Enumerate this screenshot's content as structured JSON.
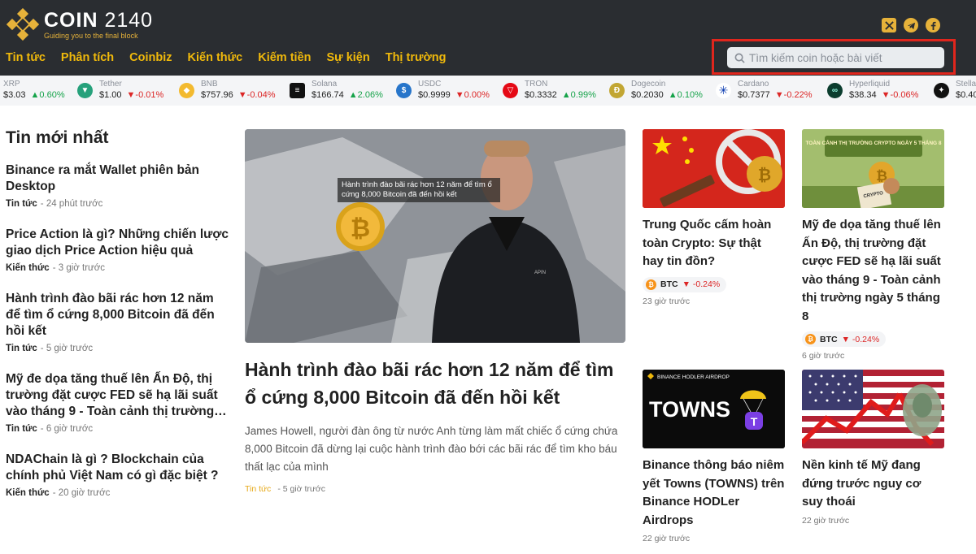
{
  "header": {
    "logo_name": "COIN",
    "logo_number": "2140",
    "logo_tagline": "Guiding you to the final block",
    "nav": [
      "Tin tức",
      "Phân tích",
      "Coinbiz",
      "Kiến thức",
      "Kiếm tiền",
      "Sự kiện",
      "Thị trường"
    ],
    "search_placeholder": "Tìm kiếm coin hoặc bài viết",
    "socials": [
      "x-icon",
      "telegram-icon",
      "facebook-icon"
    ]
  },
  "ticker": [
    {
      "name": "XRP",
      "price": "$3.03",
      "change": "0.60%",
      "direction": "up",
      "icon_color": "#23292f"
    },
    {
      "name": "Tether",
      "price": "$1.00",
      "change": "-0.01%",
      "direction": "down",
      "icon_color": "#26a17b"
    },
    {
      "name": "BNB",
      "price": "$757.96",
      "change": "-0.04%",
      "direction": "down",
      "icon_color": "#f3ba2f"
    },
    {
      "name": "Solana",
      "price": "$166.74",
      "change": "2.06%",
      "direction": "up",
      "icon_color": "#111111"
    },
    {
      "name": "USDC",
      "price": "$0.9999",
      "change": "0.00%",
      "direction": "down",
      "icon_color": "#2775ca"
    },
    {
      "name": "TRON",
      "price": "$0.3332",
      "change": "0.99%",
      "direction": "up",
      "icon_color": "#e50915"
    },
    {
      "name": "Dogecoin",
      "price": "$0.2030",
      "change": "0.10%",
      "direction": "up",
      "icon_color": "#c2a633"
    },
    {
      "name": "Cardano",
      "price": "$0.7377",
      "change": "-0.22%",
      "direction": "down",
      "icon_color": "#0033ad"
    },
    {
      "name": "Hyperliquid",
      "price": "$38.34",
      "change": "-0.06%",
      "direction": "down",
      "icon_color": "#0b3d2e"
    },
    {
      "name": "Stella",
      "price": "$0.40",
      "change": "",
      "direction": "up",
      "icon_color": "#111111"
    }
  ],
  "latest": {
    "title": "Tin mới nhất",
    "items": [
      {
        "headline": "Binance ra mắt Wallet phiên bản Desktop",
        "category": "Tin tức",
        "time": "- 24 phút trước"
      },
      {
        "headline": "Price Action là gì? Những chiến lược giao dịch Price Action hiệu quả",
        "category": "Kiến thức",
        "time": "- 3 giờ trước"
      },
      {
        "headline": "Hành trình đào bãi rác hơn 12 năm để tìm ổ cứng 8,000 Bitcoin đã đến hồi kết",
        "category": "Tin tức",
        "time": "- 5 giờ trước"
      },
      {
        "headline": "Mỹ đe dọa tăng thuế lên Ấn Độ, thị trường đặt cược FED sẽ hạ lãi suất vào tháng 9 - Toàn cảnh thị trường…",
        "category": "Tin tức",
        "time": "- 6 giờ trước"
      },
      {
        "headline": "NDAChain là gì ? Blockchain của chính phủ Việt Nam có gì đặc biệt ?",
        "category": "Kiến thức",
        "time": "- 20 giờ trước"
      }
    ]
  },
  "feature": {
    "caption": "Hành trình đào bãi rác hơn 12 năm để tìm ổ cứng 8,000 Bitcoin đã đến hồi kết",
    "title": "Hành trình đào bãi rác hơn 12 năm để tìm ổ cứng 8,000 Bitcoin đã đến hồi kết",
    "description": "James Howell, người đàn ông từ nước Anh từng làm mất chiếc ổ cứng chứa 8,000 Bitcoin đã dừng lại cuộc hành trình đào bới các bãi rác để tìm kho báu thất lạc của mình",
    "category": "Tin tức",
    "time": "- 5 giờ trước",
    "jacket_label": "APIN"
  },
  "cards": [
    {
      "title": "Trung Quốc cấm hoàn toàn Crypto: Sự thật hay tin đồn?",
      "coin": "BTC",
      "change": "-0.24%",
      "time": "23 giờ trước",
      "image": "china-crypto-ban"
    },
    {
      "title": "Mỹ đe dọa tăng thuế lên Ấn Độ, thị trường đặt cược FED sẽ hạ lãi suất vào tháng 9 - Toàn cảnh thị trường ngày 5 tháng 8",
      "coin": "BTC",
      "change": "-0.24%",
      "time": "6 giờ trước",
      "image": "market-overview",
      "image_text": "TOÀN CẢNH THỊ TRƯỜNG CRYPTO NGÀY 5 THÁNG 8",
      "paper_text": "CRYPTO"
    },
    {
      "title": "Binance thông báo niêm yết Towns (TOWNS) trên Binance HODLer Airdrops",
      "time": "22 giờ trước",
      "image": "towns-airdrop",
      "image_label": "BINANCE HODLER AIRDROP",
      "image_text": "TOWNS"
    },
    {
      "title": "Nền kinh tế Mỹ đang đứng trước nguy cơ suy thoái",
      "time": "22 giờ trước",
      "image": "us-economy"
    }
  ],
  "colors": {
    "accent": "#f0b90b",
    "header_bg": "#2a2d31",
    "up": "#16a34a",
    "down": "#dc2626",
    "highlight": "#e0261d"
  }
}
